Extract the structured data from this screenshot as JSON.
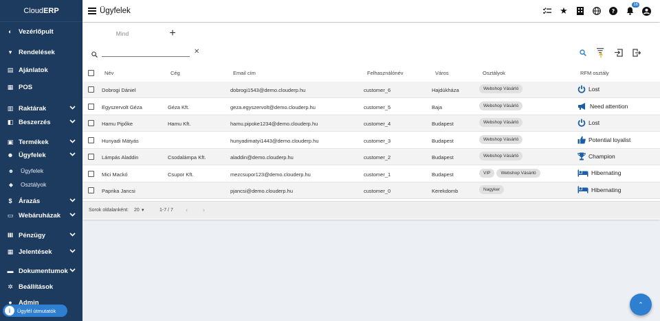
{
  "app": {
    "brand_prefix": "Cloud",
    "brand_bold": "ERP",
    "page_title": "Ügyfelek"
  },
  "sidebar": {
    "items": [
      {
        "label": "Vezérlőpult",
        "icon": "dashboard-icon",
        "glyph": "◐"
      },
      {
        "label": "Rendelések",
        "icon": "cart-icon",
        "glyph": "▾"
      },
      {
        "label": "Ajánlatok",
        "icon": "document-icon",
        "glyph": "▤"
      },
      {
        "label": "POS",
        "icon": "pos-icon",
        "glyph": "▦"
      },
      {
        "label": "Raktárak",
        "icon": "warehouse-icon",
        "glyph": "▥"
      },
      {
        "label": "Beszerzés",
        "icon": "truck-icon",
        "glyph": "◧"
      },
      {
        "label": "Termékek",
        "icon": "products-icon",
        "glyph": "▣"
      },
      {
        "label": "Ügyfelek",
        "icon": "people-icon",
        "glyph": "☻"
      },
      {
        "label": "Árazás",
        "icon": "dollar-icon",
        "glyph": "$"
      },
      {
        "label": "Webáruházak",
        "icon": "store-icon",
        "glyph": "▭"
      },
      {
        "label": "Pénzügy",
        "icon": "bank-icon",
        "glyph": "Ⅲ"
      },
      {
        "label": "Jelentések",
        "icon": "reports-icon",
        "glyph": "▦"
      },
      {
        "label": "Dokumentumok",
        "icon": "folder-icon",
        "glyph": "▬"
      },
      {
        "label": "Beállítások",
        "icon": "gear-icon",
        "glyph": "✲"
      },
      {
        "label": "Admin",
        "icon": "admin-icon",
        "glyph": "●"
      }
    ],
    "sub_items": [
      {
        "label": "Ügyfelek",
        "icon": "people-sub-icon",
        "glyph": "☻"
      },
      {
        "label": "Osztályok",
        "icon": "tag-icon",
        "glyph": "◆"
      }
    ],
    "guide_label": "Ügyfél útmutatók"
  },
  "topbar": {
    "notification_count": "16"
  },
  "tabs": [
    {
      "label": "Mind"
    },
    {
      "label": "+"
    }
  ],
  "search": {
    "value": "",
    "placeholder": ""
  },
  "table": {
    "headers": [
      "Név",
      "Cég",
      "Email cím",
      "Felhasználónév",
      "Város",
      "Osztályok",
      "RFM osztály"
    ],
    "rows": [
      {
        "name": "Dobrogi Dániel",
        "company": "",
        "email": "dobrogi1543@demo.clouderp.hu",
        "username": "customer_6",
        "city": "Hajdúkháza",
        "tags": [
          "Webshop Vásárló"
        ],
        "rfm": "Lost",
        "rfm_icon": "power-icon"
      },
      {
        "name": "Egyszervolt Géza",
        "company": "Géza Kft.",
        "email": "geza.egyszervolt@demo.clouderp.hu",
        "username": "customer_5",
        "city": "Baja",
        "tags": [
          "Webshop Vásárló"
        ],
        "rfm": "Need attention",
        "rfm_icon": "megaphone-icon"
      },
      {
        "name": "Hamu Pipőke",
        "company": "Hamu Kft.",
        "email": "hamu.pipoke1234@demo.clouderp.hu",
        "username": "customer_4",
        "city": "Budapest",
        "tags": [
          "Webshop Vásárló"
        ],
        "rfm": "Lost",
        "rfm_icon": "power-icon"
      },
      {
        "name": "Hunyadi Mátyás",
        "company": "",
        "email": "hunyadimatyi1443@demo.clouderp.hu",
        "username": "customer_3",
        "city": "Budapest",
        "tags": [
          "Webshop Vásárló"
        ],
        "rfm": "Potential loyalist",
        "rfm_icon": "thumb-up-icon"
      },
      {
        "name": "Lámpás Aladdin",
        "company": "Csodalámpa Kft.",
        "email": "aladdin@demo.clouderp.hu",
        "username": "customer_2",
        "city": "Budapest",
        "tags": [
          "Webshop Vásárló"
        ],
        "rfm": "Champion",
        "rfm_icon": "trophy-icon"
      },
      {
        "name": "Mici Mackó",
        "company": "Csupor Kft.",
        "email": "mezcsupor123@demo.clouderp.hu",
        "username": "customer_1",
        "city": "Budapest",
        "tags": [
          "VIP",
          "Webshop Vásárló"
        ],
        "rfm": "Hibernating",
        "rfm_icon": "bed-icon"
      },
      {
        "name": "Paprika Jancsi",
        "company": "",
        "email": "pjancsi@demo.clouderp.hu",
        "username": "customer_0",
        "city": "Kerekdomb",
        "tags": [
          "Nagyker"
        ],
        "rfm": "Hibernating",
        "rfm_icon": "bed-icon"
      }
    ]
  },
  "pagination": {
    "rows_per_page_label": "Sorok oldalanként:",
    "rows_per_page": "20",
    "range": "1-7 / 7"
  },
  "colors": {
    "sidebar": "#1d3a5f",
    "accent": "#2f7fd1",
    "rfm_icon": "#1c5fa8"
  }
}
